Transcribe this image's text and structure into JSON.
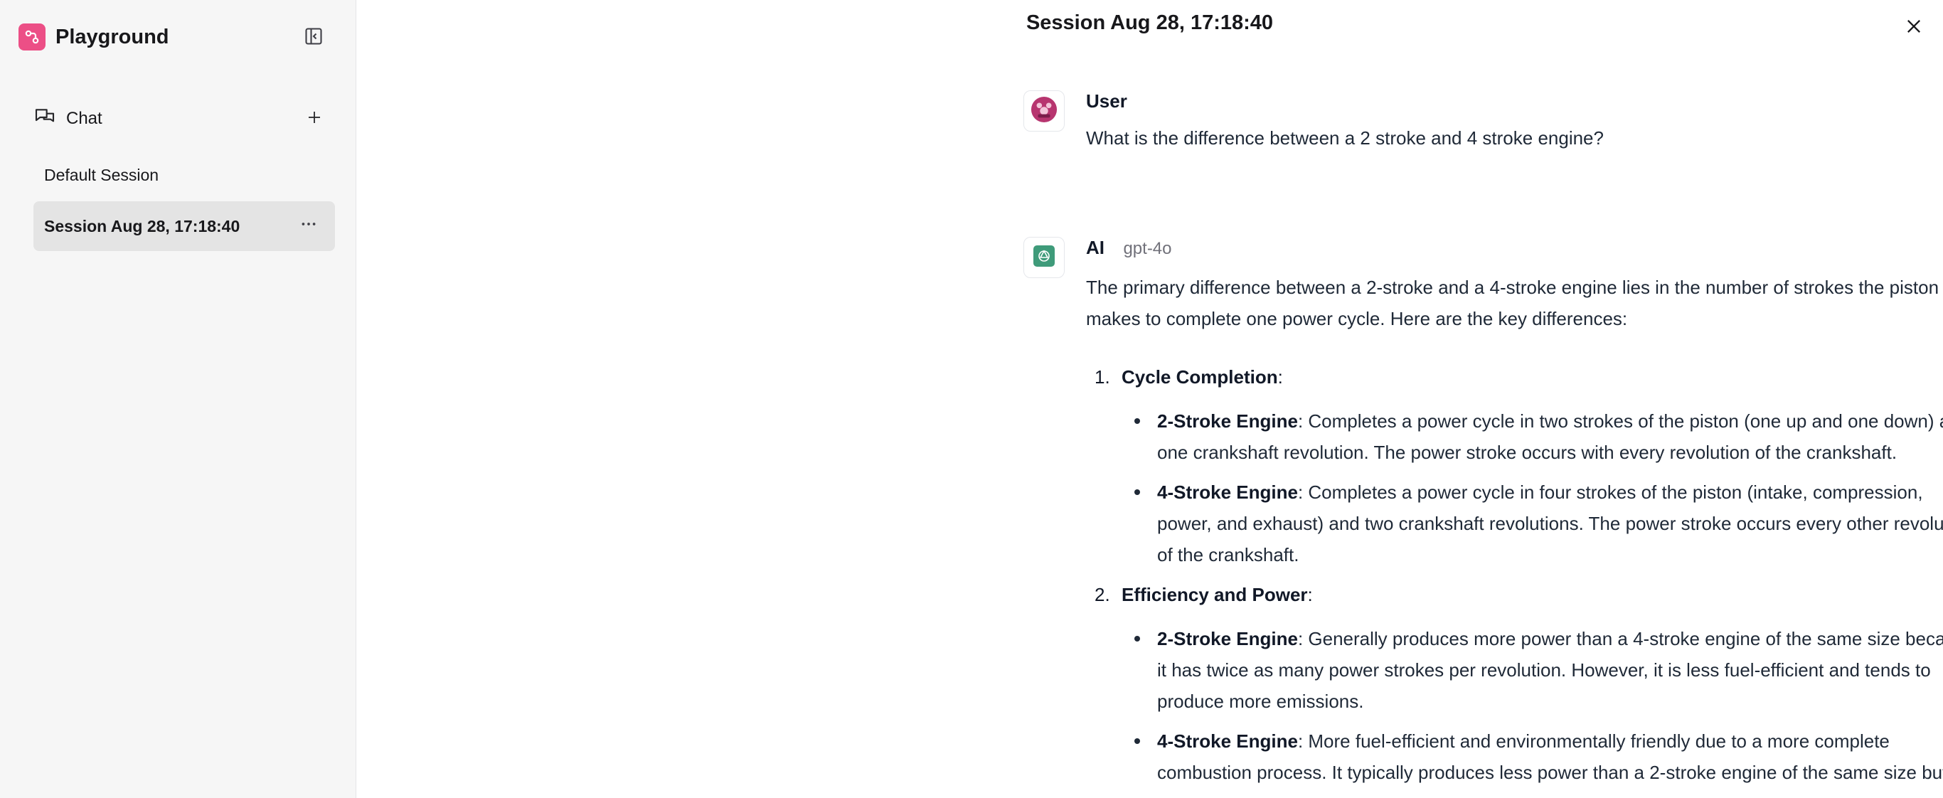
{
  "sidebar": {
    "app_title": "Playground",
    "chat_label": "Chat",
    "sessions": [
      {
        "label": "Default Session"
      },
      {
        "label": "Session Aug 28, 17:18:40"
      }
    ]
  },
  "header": {
    "session_title": "Session Aug 28, 17:18:40"
  },
  "messages": {
    "user": {
      "sender": "User",
      "text": "What is the difference between a 2 stroke and 4 stroke engine?"
    },
    "ai": {
      "sender": "AI",
      "model": "gpt-4o",
      "intro": "The primary difference between a 2-stroke and a 4-stroke engine lies in the number of strokes the piston makes to complete one power cycle. Here are the key differences:",
      "points": [
        {
          "number": "1.",
          "title": "Cycle Completion",
          "subs": [
            {
              "label": "2-Stroke Engine",
              "text": ": Completes a power cycle in two strokes of the piston (one up and one down) and one crankshaft revolution. The power stroke occurs with every revolution of the crankshaft."
            },
            {
              "label": "4-Stroke Engine",
              "text": ": Completes a power cycle in four strokes of the piston (intake, compression, power, and exhaust) and two crankshaft revolutions. The power stroke occurs every other revolution of the crankshaft."
            }
          ]
        },
        {
          "number": "2.",
          "title": "Efficiency and Power",
          "subs": [
            {
              "label": "2-Stroke Engine",
              "text": ": Generally produces more power than a 4-stroke engine of the same size because it has twice as many power strokes per revolution. However, it is less fuel-efficient and tends to produce more emissions."
            },
            {
              "label": "4-Stroke Engine",
              "text": ": More fuel-efficient and environmentally friendly due to a more complete combustion process. It typically produces less power than a 2-stroke engine of the same size but"
            }
          ]
        }
      ]
    }
  },
  "colors": {
    "brand": "#ec4f86",
    "sidebar_bg": "#f6f6f6",
    "active_session_bg": "#e4e4e4",
    "ai_avatar": "#3f9b7a",
    "user_avatar": "#b7356f"
  },
  "icons": {
    "brand": "playground-logo-icon",
    "collapse": "sidebar-collapse-icon",
    "chat": "chat-bubbles-icon",
    "add": "plus-icon",
    "more": "more-horizontal-icon",
    "close": "close-icon",
    "user": "user-avatar-icon",
    "ai": "openai-icon"
  }
}
